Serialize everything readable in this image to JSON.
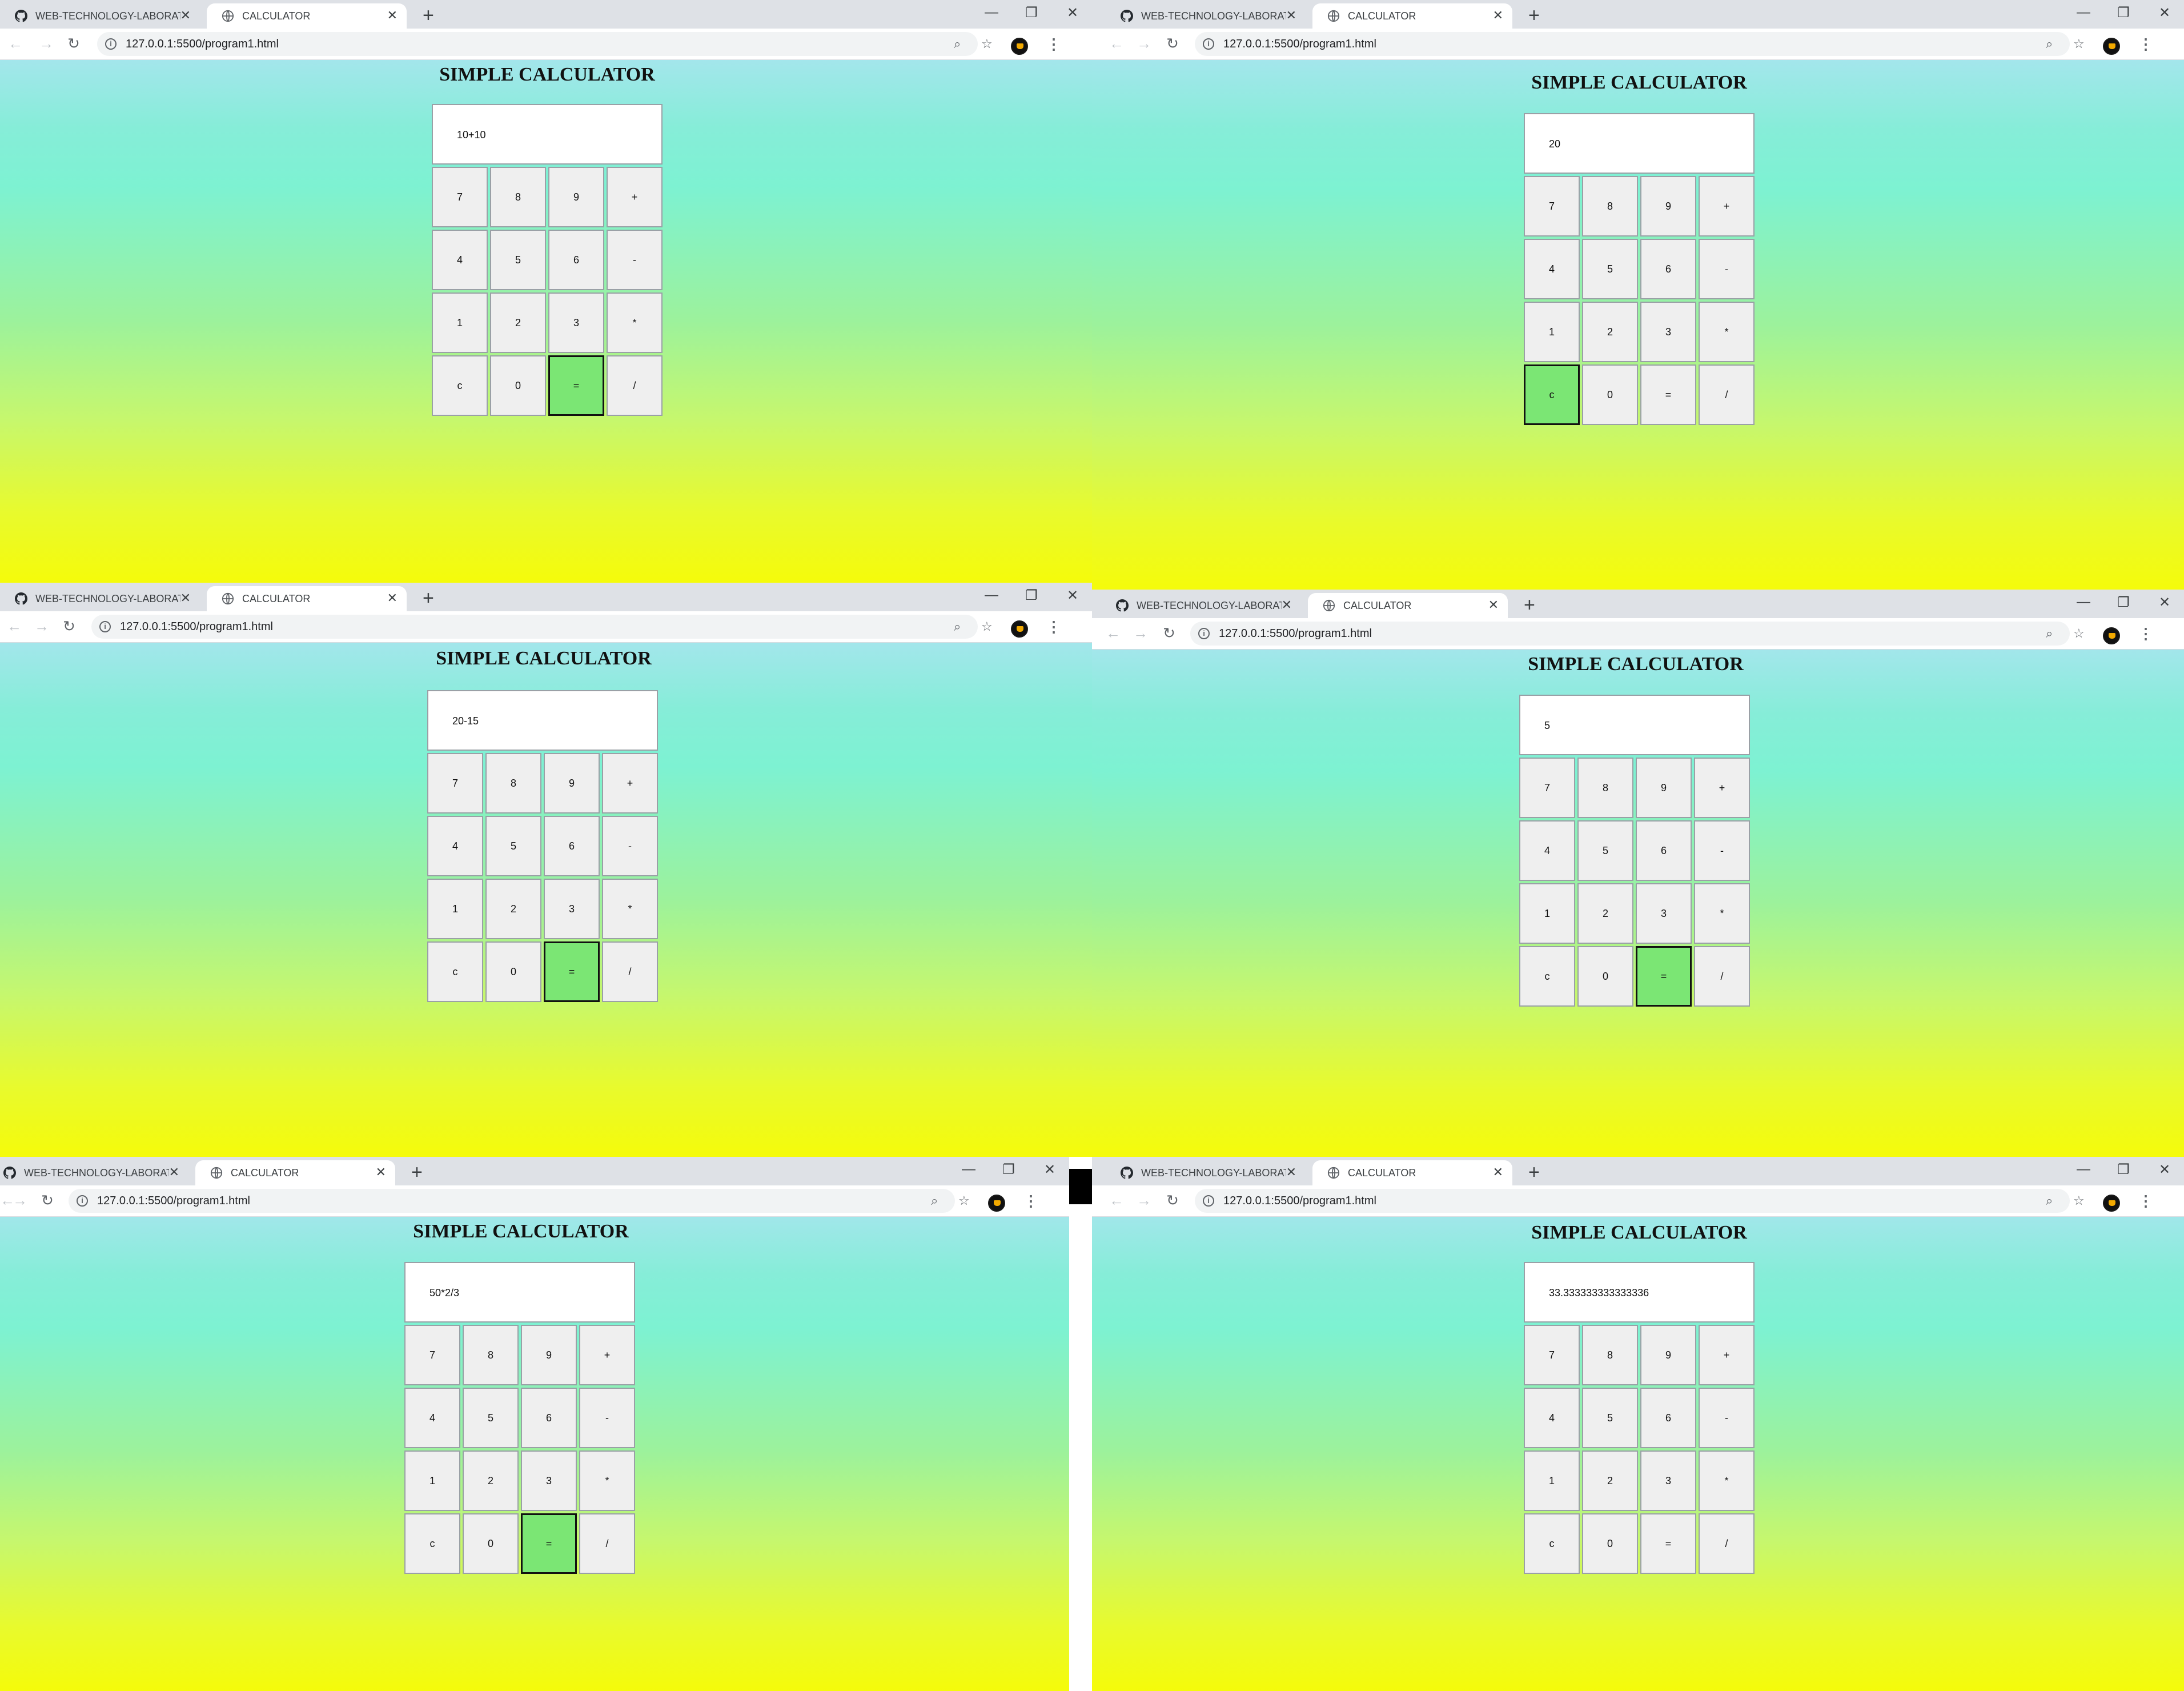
{
  "browser": {
    "tabs": [
      {
        "label": "WEB-TECHNOLOGY-LABORATORY",
        "icon": "github-icon"
      },
      {
        "label": "CALCULATOR",
        "icon": "globe-icon"
      }
    ],
    "new_tab": "+",
    "window_controls": {
      "minimize": "—",
      "restore": "❐",
      "close": "✕"
    },
    "nav": {
      "back": "←",
      "forward": "→",
      "reload": "↻"
    },
    "url": "127.0.0.1:5500/program1.html",
    "zoom_icon": "⌕",
    "star_icon": "☆",
    "menu_icon": "⋮"
  },
  "page": {
    "title": "SIMPLE CALCULATOR"
  },
  "keys": [
    "7",
    "8",
    "9",
    "+",
    "4",
    "5",
    "6",
    "-",
    "1",
    "2",
    "3",
    "*",
    "c",
    "0",
    "=",
    "/"
  ],
  "panels": [
    {
      "display": "10+10",
      "active_key": "="
    },
    {
      "display": "20",
      "active_key": "c"
    },
    {
      "display": "20-15",
      "active_key": "="
    },
    {
      "display": "5",
      "active_key": "="
    },
    {
      "display": "50*2/3",
      "active_key": "="
    },
    {
      "display": "33.333333333333336",
      "active_key": ""
    }
  ],
  "colors": {
    "gradient_top": "#b3e1f5",
    "gradient_mid": "#7df2d2",
    "gradient_bottom": "#f5fb0a",
    "active_key": "#7be674"
  }
}
